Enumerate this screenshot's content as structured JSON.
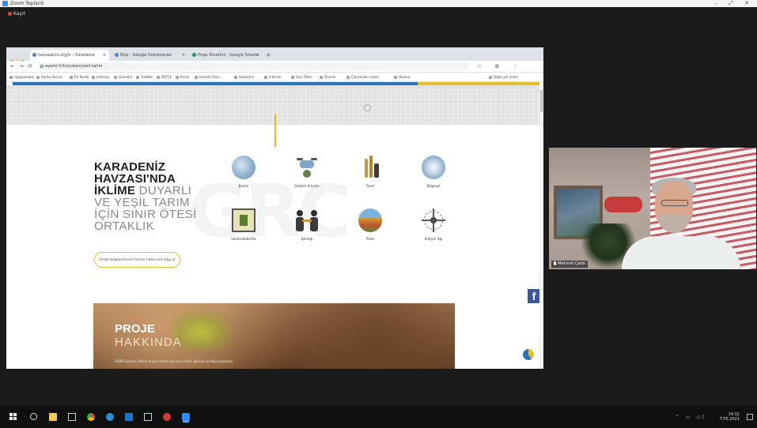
{
  "window": {
    "title": "Zoom Toplantı",
    "controls": "–  ⤢  ✕"
  },
  "recording": {
    "label": "Kayıt"
  },
  "browser": {
    "tabs": [
      {
        "label": "havzaaicin.org/tr › Karadeniz Havzası"
      },
      {
        "label": "Ekip - Google Dokümanlar"
      },
      {
        "label": "Proje Yönetimi - Google Sheets"
      }
    ],
    "new_tab": "+",
    "url": "ayarkr.tr/tr/yukarı/yesil-tarim",
    "nav": {
      "back": "←",
      "forward": "→",
      "reload": "⟳"
    },
    "right_icons": "☆ ⊕ ⋮",
    "bookmarks": [
      "Uygulamalar",
      "Harita Servisi",
      "EU Portal",
      "Lifelong",
      "Gündem",
      "TraWeb",
      "BÜTÇE",
      "Kırsal",
      "Hazırlık Planı",
      "Sözleşme",
      "İndirme",
      "Sınır Ötesi",
      "Önemli",
      "Çalışmalar Listesi",
      "Okuma",
      "Diğer yer imleri"
    ]
  },
  "site": {
    "hero_lines": [
      {
        "text": "KARADENİZ",
        "style": "b"
      },
      {
        "text": "HAVZASI'NDA",
        "style": "b"
      },
      {
        "bold": "İKLİME",
        "thin": " DUYARLI"
      },
      {
        "text": "VE YEŞİL TARIM",
        "style": "t"
      },
      {
        "text": "İÇİN SINIR ÖTESİ",
        "style": "t"
      },
      {
        "text": "ORTAKLIK",
        "style": "t"
      }
    ],
    "watermark": "GRC",
    "cta": "Ortak bilgilendirme formu hakkında bilgi al",
    "icons": [
      {
        "label": "Belirle",
        "icon": "water-globe-icon"
      },
      {
        "label": "Gözlem Araçları",
        "icon": "drone-icon"
      },
      {
        "label": "Tarım",
        "icon": "wheat-icon"
      },
      {
        "label": "Bölgesel",
        "icon": "region-map-icon"
      },
      {
        "label": "Sürdürülebilirlik",
        "icon": "green-book-icon"
      },
      {
        "label": "İşbirliği",
        "icon": "handshake-icon"
      },
      {
        "label": "Arazi",
        "icon": "landscape-icon"
      },
      {
        "label": "İletişim Ağı",
        "icon": "network-icon"
      }
    ],
    "proje_title": "PROJE",
    "proje_sub": "HAKKINDA",
    "proje_text": "GRIBS projesi, iklime duyarlı tarım için sınır ötesi işbirliği ve bilgi paylaşımı"
  },
  "facebook": {
    "label": "f"
  },
  "video": {
    "participant": "Mehmet Çetin"
  },
  "taskbar": {
    "time": "14:32",
    "date": "7.05.2021",
    "tray": "⌃ ▭ ◁)",
    "icons": [
      "windows-start-icon",
      "search-icon",
      "file-explorer-icon",
      "task-view-icon",
      "chrome-icon",
      "edge-icon",
      "mail-icon",
      "store-icon",
      "office-icon",
      "zoom-icon"
    ]
  },
  "colors": {
    "accent_blue": "#2c74b8",
    "accent_yellow": "#e4be2e",
    "facebook": "#3b5998",
    "zoom_bg": "#1b1b1b"
  }
}
